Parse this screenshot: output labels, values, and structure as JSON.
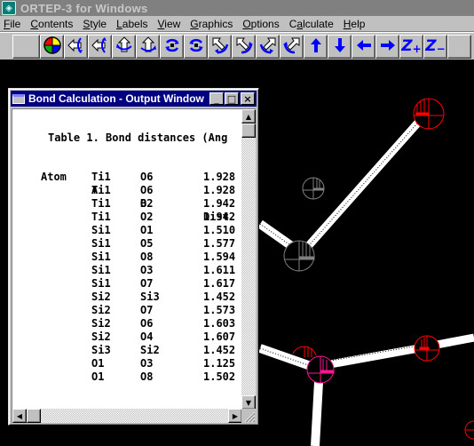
{
  "app": {
    "title": "ORTEP-3 for Windows",
    "icon": "ortep-app-icon"
  },
  "menu": [
    {
      "label": "File",
      "accel": "F",
      "rest": "ile"
    },
    {
      "label": "Contents",
      "accel": "C",
      "rest": "ontents"
    },
    {
      "label": "Style",
      "accel": "S",
      "rest": "tyle"
    },
    {
      "label": "Labels",
      "accel": "L",
      "rest": "abels"
    },
    {
      "label": "View",
      "accel": "V",
      "rest": "iew"
    },
    {
      "label": "Graphics",
      "accel": "G",
      "rest": "raphics"
    },
    {
      "label": "Options",
      "accel": "O",
      "rest": "ptions"
    },
    {
      "label": "Calculate",
      "pre": "C",
      "accel": "a",
      "rest": "lculate"
    },
    {
      "label": "Help",
      "accel": "H",
      "rest": "elp"
    }
  ],
  "toolbar": {
    "buttons": [
      {
        "name": "blank-button",
        "icon": "none"
      },
      {
        "name": "color-button",
        "icon": "color-wheel-icon"
      },
      {
        "name": "rotate-left-ccw-button",
        "icon": "rotate-y-left-icon"
      },
      {
        "name": "rotate-left-cw-button",
        "icon": "rotate-y-right-icon"
      },
      {
        "name": "rotate-up-ccw-button",
        "icon": "rotate-x-up-icon"
      },
      {
        "name": "rotate-up-cw-button",
        "icon": "rotate-x-down-icon"
      },
      {
        "name": "spin-cw-button",
        "icon": "rotate-z-cw-icon"
      },
      {
        "name": "spin-ccw-button",
        "icon": "rotate-z-ccw-icon"
      },
      {
        "name": "diag-rotate-1-button",
        "icon": "diagonal-rotate-1-icon"
      },
      {
        "name": "diag-rotate-2-button",
        "icon": "diagonal-rotate-2-icon"
      },
      {
        "name": "diag-rotate-3-button",
        "icon": "diagonal-rotate-3-icon"
      },
      {
        "name": "diag-rotate-4-button",
        "icon": "diagonal-rotate-4-icon"
      },
      {
        "name": "move-up-button",
        "icon": "arrow-up-icon",
        "glyph": "🡑"
      },
      {
        "name": "move-down-button",
        "icon": "arrow-down-icon",
        "glyph": "🡓"
      },
      {
        "name": "move-left-button",
        "icon": "arrow-left-icon",
        "glyph": "🡐"
      },
      {
        "name": "move-right-button",
        "icon": "arrow-right-icon",
        "glyph": "🡒"
      },
      {
        "name": "zoom-in-button",
        "icon": "z-plus-icon",
        "glyph": "Z",
        "sub": "+"
      },
      {
        "name": "zoom-out-button",
        "icon": "z-minus-icon",
        "glyph": "Z",
        "sub": "−"
      },
      {
        "name": "blank-button-2",
        "icon": "none"
      }
    ]
  },
  "output_window": {
    "title": "Bond Calculation - Output Window",
    "minimize": "_",
    "maximize": "□",
    "close": "×",
    "heading": "Table 1. Bond distances (Ang",
    "columns": [
      "Atom",
      "A",
      "B",
      "Dist"
    ],
    "rows": [
      {
        "atom": "",
        "a": "Ti1",
        "b": "O6",
        "dist": "1.928"
      },
      {
        "atom": "",
        "a": "Ti1",
        "b": "O6",
        "dist": "1.928"
      },
      {
        "atom": "",
        "a": "Ti1",
        "b": "O2",
        "dist": "1.942"
      },
      {
        "atom": "",
        "a": "Ti1",
        "b": "O2",
        "dist": "1.942"
      },
      {
        "atom": "",
        "a": "Si1",
        "b": "O1",
        "dist": "1.510"
      },
      {
        "atom": "",
        "a": "Si1",
        "b": "O5",
        "dist": "1.577"
      },
      {
        "atom": "",
        "a": "Si1",
        "b": "O8",
        "dist": "1.594"
      },
      {
        "atom": "",
        "a": "Si1",
        "b": "O3",
        "dist": "1.611"
      },
      {
        "atom": "",
        "a": "Si1",
        "b": "O7",
        "dist": "1.617"
      },
      {
        "atom": "",
        "a": "Si2",
        "b": "Si3",
        "dist": "1.452"
      },
      {
        "atom": "",
        "a": "Si2",
        "b": "O7",
        "dist": "1.573"
      },
      {
        "atom": "",
        "a": "Si2",
        "b": "O6",
        "dist": "1.603"
      },
      {
        "atom": "",
        "a": "Si2",
        "b": "O4",
        "dist": "1.607"
      },
      {
        "atom": "",
        "a": "Si3",
        "b": "Si2",
        "dist": "1.452"
      },
      {
        "atom": "",
        "a": "O1",
        "b": "O3",
        "dist": "1.125"
      },
      {
        "atom": "",
        "a": "O1",
        "b": "O8",
        "dist": "1.502"
      }
    ],
    "scroll": {
      "up": "▲",
      "down": "▼",
      "left": "◀",
      "right": "▶"
    }
  },
  "colors": {
    "oxygen": "#ff0000",
    "silicon": "#808080",
    "titanium": "#ff1493",
    "bond": "#ffffff",
    "background": "#000000"
  }
}
